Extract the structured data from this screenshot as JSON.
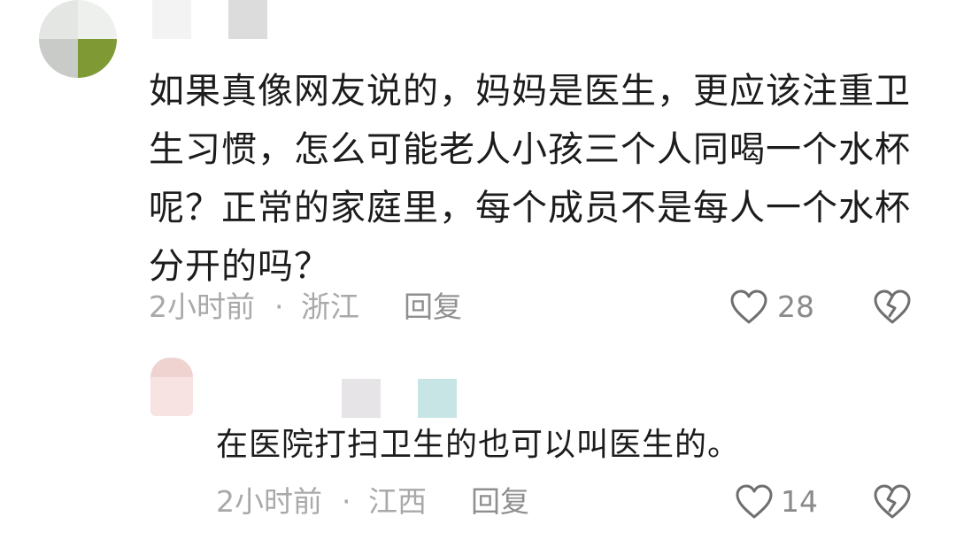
{
  "comments": [
    {
      "text_lines": [
        "如果真像网友说的，妈妈是医生，更应该注重卫",
        "生习惯，怎么可能老人小孩三个人同喝一个水杯",
        "呢？正常的家庭里，每个成员不是每人一个水杯",
        "分开的吗？"
      ],
      "time": "2小时前",
      "separator": "·",
      "location": "浙江",
      "reply_label": "回复",
      "like_count": "28",
      "like_icon": "heart-outline-icon",
      "dislike_icon": "broken-heart-icon"
    },
    {
      "text": "在医院打扫卫生的也可以叫医生的。",
      "time": "2小时前",
      "separator": "·",
      "location": "江西",
      "reply_label": "回复",
      "like_count": "14",
      "like_icon": "heart-outline-icon",
      "dislike_icon": "broken-heart-icon"
    }
  ],
  "colors": {
    "body_text": "#1c1c1c",
    "meta_text": "#a9a9a9",
    "icon_stroke": "#6f6f6f"
  }
}
